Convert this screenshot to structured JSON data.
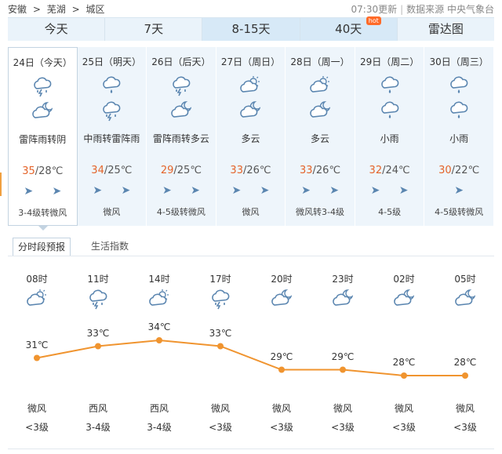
{
  "breadcrumb": [
    "安徽",
    ">",
    "芜湖",
    ">",
    "城区"
  ],
  "update_time": "07:30更新",
  "source": "数据来源 中央气象台",
  "tabs": [
    {
      "label": "今天"
    },
    {
      "label": "7天"
    },
    {
      "label": "8-15天"
    },
    {
      "label": "40天",
      "badge": "hot"
    },
    {
      "label": "雷达图"
    }
  ],
  "days": [
    {
      "label": "24日（今天）",
      "icons": [
        "thunder-rain-icon",
        "cloudy-night-icon"
      ],
      "desc": "雷阵雨转阴",
      "high": "35",
      "low": "/28℃",
      "dirs": "➤  ➤",
      "wind": "3-4级转微风"
    },
    {
      "label": "25日（明天）",
      "icons": [
        "rain-icon",
        "thunder-rain-icon"
      ],
      "desc": "中雨转雷阵雨",
      "high": "34",
      "low": "/25℃",
      "dirs": "➤  ➤",
      "wind": "微风"
    },
    {
      "label": "26日（后天）",
      "icons": [
        "thunder-rain-icon",
        "cloudy-night-icon"
      ],
      "desc": "雷阵雨转多云",
      "high": "29",
      "low": "/25℃",
      "dirs": "➤  ➤",
      "wind": "4-5级转微风"
    },
    {
      "label": "27日（周日）",
      "icons": [
        "partly-cloudy-icon",
        "cloudy-night-icon"
      ],
      "desc": "多云",
      "high": "33",
      "low": "/26℃",
      "dirs": "➤  ➤",
      "wind": "微风"
    },
    {
      "label": "28日（周一）",
      "icons": [
        "partly-cloudy-icon",
        "cloudy-night-icon"
      ],
      "desc": "多云",
      "high": "33",
      "low": "/26℃",
      "dirs": "➤  ➤",
      "wind": "微风转3-4级"
    },
    {
      "label": "29日（周二）",
      "icons": [
        "rain-icon",
        "rain-icon"
      ],
      "desc": "小雨",
      "high": "32",
      "low": "/24℃",
      "dirs": "➤  ➤",
      "wind": "4-5级"
    },
    {
      "label": "30日（周三）",
      "icons": [
        "rain-icon",
        "rain-icon"
      ],
      "desc": "小雨",
      "high": "30",
      "low": "/22℃",
      "dirs": "➤",
      "wind": "4-5级转微风"
    }
  ],
  "subtabs": {
    "active": "分时段预报",
    "other": "生活指数"
  },
  "hours": [
    {
      "time": "08时",
      "icon": "partly-cloudy-icon",
      "temp": "31℃",
      "value": 31,
      "dir": "微风",
      "level": "<3级"
    },
    {
      "time": "11时",
      "icon": "thunder-rain-icon",
      "temp": "33℃",
      "value": 33,
      "dir": "西风",
      "level": "3-4级"
    },
    {
      "time": "14时",
      "icon": "partly-cloudy-icon",
      "temp": "34℃",
      "value": 34,
      "dir": "西风",
      "level": "3-4级"
    },
    {
      "time": "17时",
      "icon": "thunder-rain-icon",
      "temp": "33℃",
      "value": 33,
      "dir": "微风",
      "level": "<3级"
    },
    {
      "time": "20时",
      "icon": "cloudy-night-icon",
      "temp": "29℃",
      "value": 29,
      "dir": "微风",
      "level": "<3级"
    },
    {
      "time": "23时",
      "icon": "cloudy-night-icon",
      "temp": "29℃",
      "value": 29,
      "dir": "微风",
      "level": "<3级"
    },
    {
      "time": "02时",
      "icon": "cloudy-night-icon",
      "temp": "28℃",
      "value": 28,
      "dir": "微风",
      "level": "<3级"
    },
    {
      "time": "05时",
      "icon": "cloudy-night-icon",
      "temp": "28℃",
      "value": 28,
      "dir": "微风",
      "level": "<3级"
    }
  ],
  "colors": {
    "accent_orange": "#f0942f",
    "temp_high": "#e4642a",
    "icon_blue": "#5b86b0"
  }
}
